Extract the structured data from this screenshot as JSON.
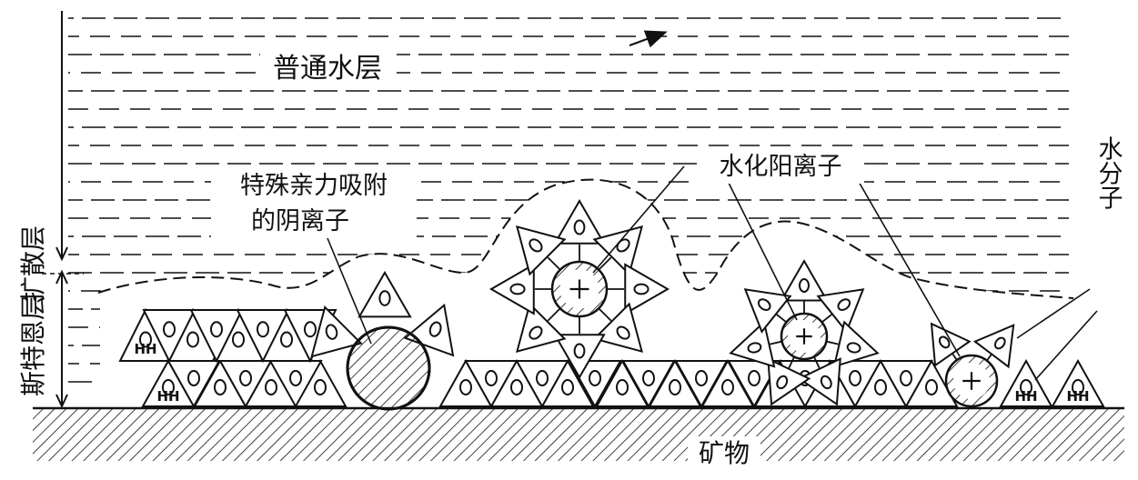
{
  "labels": {
    "normal_water_layer": "普通水层",
    "diffuse_layer": "扩散层",
    "stern_layer": "斯特恩层",
    "special_adsorbed_anions_line1": "特殊亲力吸附",
    "special_adsorbed_anions_line2": "的阴离子",
    "hydrated_cations": "水化阳离子",
    "water_molecule": "水分子",
    "mineral": "矿物"
  },
  "symbols": {
    "hydrogen_pair": "HH"
  },
  "colors": {
    "ink": "#111111",
    "background": "#ffffff"
  }
}
